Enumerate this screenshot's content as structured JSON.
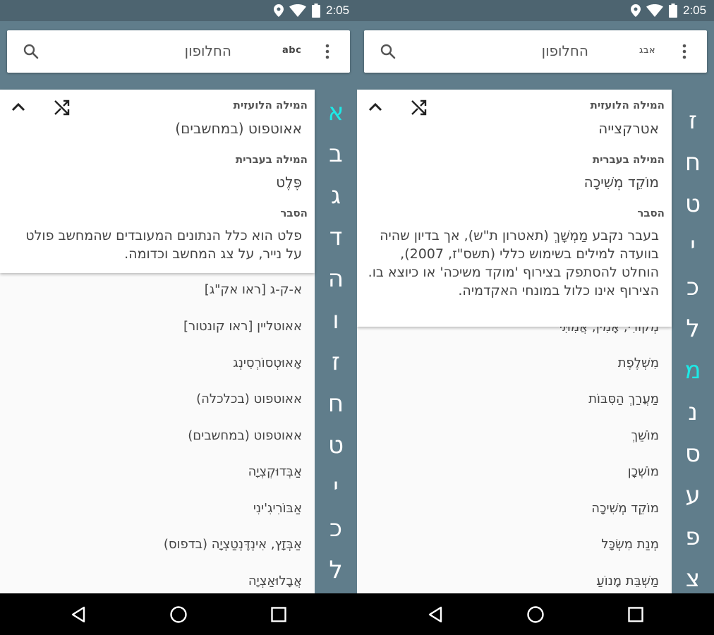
{
  "status": {
    "time": "2:05"
  },
  "left": {
    "search_label": "החלופון",
    "mode_label": "abc",
    "letters": [
      {
        "char": "א",
        "active": true
      },
      {
        "char": "ב",
        "active": false
      },
      {
        "char": "ג",
        "active": false
      },
      {
        "char": "ד",
        "active": false
      },
      {
        "char": "ה",
        "active": false
      },
      {
        "char": "ו",
        "active": false
      },
      {
        "char": "ז",
        "active": false
      },
      {
        "char": "ח",
        "active": false
      },
      {
        "char": "ט",
        "active": false
      },
      {
        "char": "י",
        "active": false
      },
      {
        "char": "כ",
        "active": false
      },
      {
        "char": "ל",
        "active": false
      }
    ],
    "card": {
      "foreign_label": "המילה הלועזית",
      "foreign_value": "אאוטפוט (במחשבים)",
      "hebrew_label": "המילה בעברית",
      "hebrew_value": "פֶּלֶט",
      "explain_label": "הסבר",
      "explain_text": "פלט הוא כלל הנתונים המעובדים שהמחשב פולט על נייר, על צג המחשב וכדומה."
    },
    "list": [
      "א-ק-ג [ראו אק\"ג]",
      "אאוטליין [ראו קונטור]",
      "אָאוּטְסוֹרְסִינְג",
      "אאוטפוט (בכלכלה)",
      "אאוטפוט (במחשבים)",
      "אַבְּדוּקְצְיָה",
      "אַבּוֹרִיגִ'ינִי",
      "אַבְּזָץ, אִינְדֶּנְטַצְיָה (בדפוס)",
      "אֲבָלוּאַצְיָה"
    ]
  },
  "right": {
    "search_label": "החלופון",
    "mode_label": "אבג",
    "letters": [
      {
        "char": "ז",
        "active": false
      },
      {
        "char": "ח",
        "active": false
      },
      {
        "char": "ט",
        "active": false
      },
      {
        "char": "י",
        "active": false
      },
      {
        "char": "כ",
        "active": false
      },
      {
        "char": "ל",
        "active": false
      },
      {
        "char": "מ",
        "active": true
      },
      {
        "char": "נ",
        "active": false
      },
      {
        "char": "ס",
        "active": false
      },
      {
        "char": "ע",
        "active": false
      },
      {
        "char": "פ",
        "active": false
      },
      {
        "char": "צ",
        "active": false
      }
    ],
    "card": {
      "foreign_label": "המילה הלועזית",
      "foreign_value": "אטרקצייה",
      "hebrew_label": "המילה בעברית",
      "hebrew_value": "מוֹקֵד מְשִׁיכָה",
      "explain_label": "הסבר",
      "explain_text": "בעבר נקבע מַמְשָׁךְ (תאטרון ת\"ש), אך בדיון שהיה בוועדה למילים בשימוש כללי (תשס\"ז, 2007), הוחלט להסתפק בצירוף 'מוקד משיכה' או כיוצא בו. הצירוף אינו כלול במונחי האקדמיה."
    },
    "list": [
      "מְקוֹרִי; אָמִין; אֲמִתִּי",
      "מִשְׁלֶפֶת",
      "מַעֲרַךְ הַסִּבּוֹת",
      "מוֹשֵׁךְ",
      "מוֹשְׁכָן",
      "מוֹקֵד מְשִׁיכָה",
      "מְנַת מִשְׂכָּל",
      "מַשְׁבֵּת מָנוֹעַ"
    ]
  }
}
